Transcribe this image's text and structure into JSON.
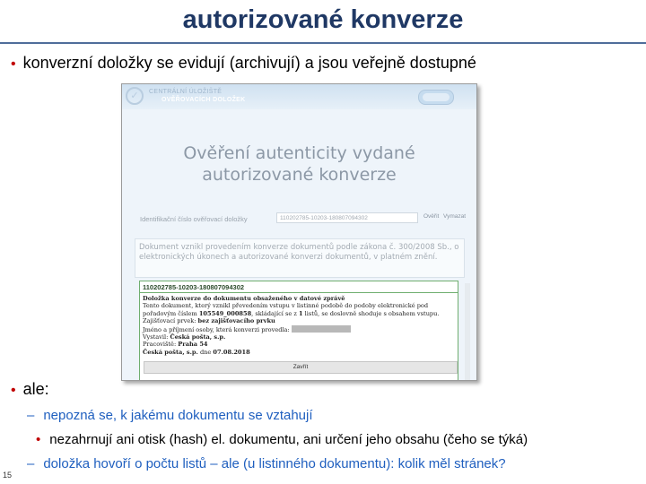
{
  "slide": {
    "title": "autorizované konverze",
    "page_number": "15"
  },
  "bullets": {
    "b1": "konverzní doložky se evidují (archivují) a jsou veřejně dostupné",
    "b2": "ale:",
    "sub1": "nepozná se, k jakému dokumentu se vztahují",
    "sub2": "nezahrnují ani otisk (hash) el. dokumentu, ani určení jeho obsahu (čeho se týká)",
    "sub3": "doložka hovoří o počtu listů – ale (u listinného dokumentu): kolik měl stránek?"
  },
  "screenshot": {
    "brand_line1": "CENTRÁLNÍ ÚLOŽIŠTĚ",
    "brand_line2": "OVĚŘOVACÍCH DOLOŽEK",
    "heading_line1": "Ověření autenticity vydané",
    "heading_line2": "autorizované konverze",
    "id_label": "Identifikační číslo ověřovací doložky",
    "id_value": "110202785-10203-180807094302",
    "verify_button": "Ověřit",
    "clear_button": "Vymazat",
    "info_text": "Dokument vznikl provedením konverze dokumentů podle zákona č. 300/2008 Sb., o elektronických úkonech a autorizované konverzi dokumentů, v platném znění.",
    "result": {
      "code": "110202785-10203-180807094302",
      "heading": "Doložka konverze do dokumentu obsaženého v datové zprávě",
      "text_pre": "Tento dokument, který vznikl převedením vstupu v listinné podobě do podoby elektronické pod pořadovým číslem ",
      "serial": "105549_000858",
      "text_mid": ", skládající se z ",
      "sheets": "1",
      "text_post": " listů, se doslovně shoduje s obsahem vstupu.",
      "security_label": "Zajišťovací prvek: ",
      "security_value": "bez zajišťovacího prvku",
      "person_label": "Jméno a příjmení osoby, která konverzi provedla: ",
      "issuer_label": "Vystavil: ",
      "issuer_value": "Česká pošta, s.p.",
      "workplace_label": "Pracoviště: ",
      "workplace_value": "Praha 54",
      "date_pre": "Česká pošta, s.p.",
      "date_mid": " dne ",
      "date_value": "07.08.2018"
    },
    "close_button": "Zavřít"
  }
}
